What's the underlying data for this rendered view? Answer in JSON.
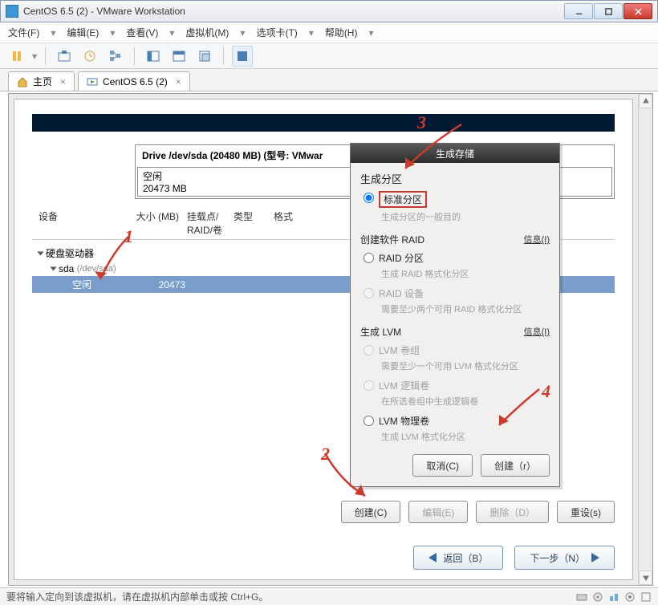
{
  "window": {
    "title": "CentOS 6.5 (2) - VMware Workstation"
  },
  "menubar": {
    "file": "文件(F)",
    "edit": "编辑(E)",
    "view": "查看(V)",
    "vm": "虚拟机(M)",
    "tabs": "选项卡(T)",
    "help": "帮助(H)"
  },
  "tabs": {
    "home": "主页",
    "vm": "CentOS 6.5 (2)"
  },
  "drive": {
    "header": "Drive /dev/sda (20480 MB) (型号: VMwar",
    "free_label": "空闲",
    "free_size": "20473 MB"
  },
  "columns": {
    "device": "设备",
    "size": "大小 (MB)",
    "mount": "挂载点/ RAID/卷",
    "type": "类型",
    "format": "格式"
  },
  "tree": {
    "root": "硬盘驱动器",
    "dev": "sda",
    "dev_path": "(/dev/sda)",
    "free": "空闲",
    "free_size": "20473"
  },
  "main_buttons": {
    "create": "创建(C)",
    "edit": "编辑(E)",
    "delete": "删除（D）",
    "reset": "重设(s)"
  },
  "nav": {
    "back": "返回（B）",
    "next": "下一步（N）"
  },
  "dialog": {
    "title": "生成存储",
    "sec_partition": "生成分区",
    "std_part": "标准分区",
    "std_hint": "生成分区的一般目的",
    "sec_raid": "创建软件 RAID",
    "info": "信息(I)",
    "raid_part": "RAID 分区",
    "raid_part_hint": "生成 RAID 格式化分区",
    "raid_dev": "RAID 设备",
    "raid_dev_hint": "需要至少两个可用 RAID 格式化分区",
    "sec_lvm": "生成 LVM",
    "lvm_vg": "LVM 卷组",
    "lvm_vg_hint": "需要至少一个可用 LVM 格式化分区",
    "lvm_lv": "LVM 逻辑卷",
    "lvm_lv_hint": "在所选卷组中生成逻辑卷",
    "lvm_pv": "LVM 物理卷",
    "lvm_pv_hint": "生成 LVM 格式化分区",
    "cancel": "取消(C)",
    "create": "创建（r）"
  },
  "status": {
    "text": "要将输入定向到该虚拟机，请在虚拟机内部单击或按 Ctrl+G。"
  },
  "annotations": {
    "n1": "1",
    "n2": "2",
    "n3": "3",
    "n4": "4"
  }
}
